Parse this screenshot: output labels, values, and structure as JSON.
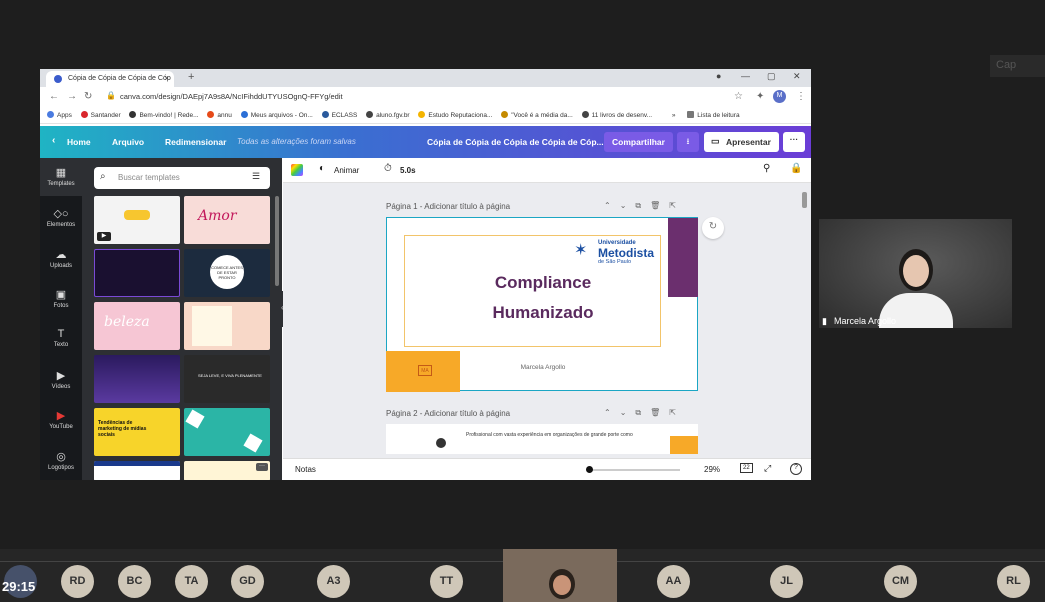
{
  "meeting": {
    "ghost_button": "Cap",
    "timer": "29:15"
  },
  "browser": {
    "tab_title": "Cópia de Cópia de Cópia de Cóp",
    "new_tab": "+",
    "url": "canva.com/design/DAEpj7A9s8A/NcIFihddUTYUSOgnQ-FFYg/edit",
    "profile_initial": "M",
    "bookmarks": [
      "Apps",
      "Santander",
      "Bem-vindo! | Rede...",
      "annu",
      "Meus arquivos - On...",
      "ECLASS",
      "aluno.fgv.br",
      "Estudo Reputaciona...",
      "\"Você é a média da...",
      "11 livros de desenv..."
    ],
    "reading_list": "Lista de leitura",
    "more": "»"
  },
  "canva": {
    "header": {
      "home": "Home",
      "file": "Arquivo",
      "resize": "Redimensionar",
      "saved_status": "Todas as alterações foram salvas",
      "doc_title": "Cópia de Cópia de Cópia de Cópia de Cóp...",
      "share": "Compartilhar",
      "present": "Apresentar",
      "more": "···"
    },
    "rail": [
      {
        "label": "Templates",
        "icon": "templates-icon"
      },
      {
        "label": "Elementos",
        "icon": "elements-icon"
      },
      {
        "label": "Uploads",
        "icon": "upload-icon"
      },
      {
        "label": "Fotos",
        "icon": "photos-icon"
      },
      {
        "label": "Texto",
        "icon": "text-icon"
      },
      {
        "label": "Vídeos",
        "icon": "video-icon"
      },
      {
        "label": "YouTube",
        "icon": "youtube-icon"
      },
      {
        "label": "Logotipos",
        "icon": "logos-icon"
      }
    ],
    "panel": {
      "search_placeholder": "Buscar templates",
      "thumbs": [
        {
          "text": ""
        },
        {
          "text": "Amor"
        },
        {
          "text": ""
        },
        {
          "text": "COMECE ANTES DE ESTAR PRONTO"
        },
        {
          "text": "beleza"
        },
        {
          "text": ""
        },
        {
          "text": ""
        },
        {
          "text": "SEJA LEVE, E VIVA PLENAMENTE"
        },
        {
          "text": "Tendências de marketing de mídias sociais"
        },
        {
          "text": ""
        }
      ]
    },
    "toolbar": {
      "animate": "Animar",
      "duration": "5.0s"
    },
    "page1": {
      "label": "Página 1 - Adicionar título à página",
      "university_top": "Universidade",
      "university_name": "Metodista",
      "university_sub": "de São Paulo",
      "title_line1": "Compliance",
      "title_line2": "Humanizado",
      "author": "Marcela Argollo",
      "badge": "MA"
    },
    "page2": {
      "label": "Página 2 - Adicionar título à página",
      "text": "Profissional com vasta experiência em organizações de grande porte como"
    },
    "footer": {
      "notes": "Notas",
      "zoom": "29%",
      "page_count": "22"
    }
  },
  "video_tile": {
    "name": "Marcela Argollo"
  },
  "participants": [
    "RD",
    "BC",
    "TA",
    "GD",
    "A3",
    "TT",
    "AA",
    "JL",
    "CM",
    "RL"
  ],
  "colors": {
    "accent_purple": "#6b2f6e",
    "accent_orange": "#f7a928",
    "logo_blue": "#1b4fa2"
  }
}
